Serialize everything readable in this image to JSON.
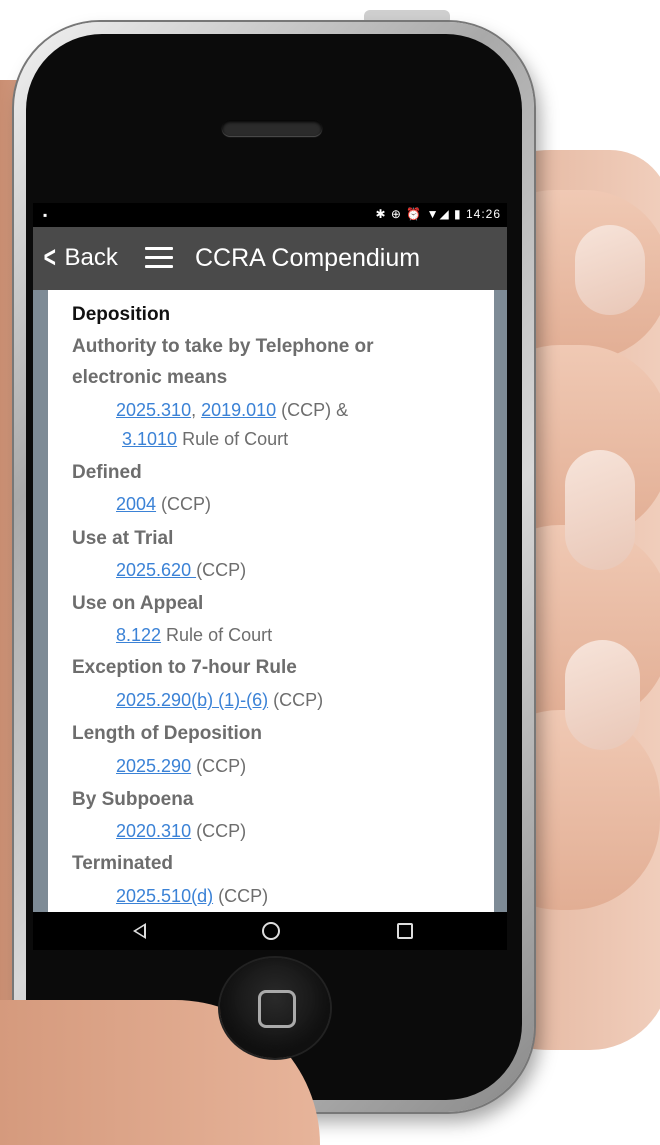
{
  "statusbar": {
    "left_icon": "notification-icon",
    "right_icons": "✱ ⊕ ⏰ ▼◢ ▮",
    "time": "14:26"
  },
  "appbar": {
    "back_label": "Back",
    "title": "CCRA Compendium"
  },
  "content": {
    "heading": "Deposition",
    "entries": [
      {
        "title_line1": "Authority to take by Telephone or",
        "title_line2": "electronic means"
      },
      {
        "title": "Defined"
      },
      {
        "title": "Use at Trial"
      },
      {
        "title": "Use on Appeal"
      },
      {
        "title": "Exception to 7-hour Rule"
      },
      {
        "title": "Length of Deposition"
      },
      {
        "title": "By Subpoena"
      },
      {
        "title": "Terminated"
      }
    ],
    "refs": {
      "r1a": "2025.310",
      "r1sep": ", ",
      "r1b": "2019.010",
      "r1tail": "  (CCP)  &",
      "r1c": "3.1010",
      "r1ctail": " Rule of Court",
      "r2": "2004",
      "r2tail": "  (CCP)",
      "r3": "2025.620 ",
      "r3tail": "(CCP)",
      "r4": "8.122",
      "r4tail": " Rule of Court",
      "r5": "2025.290(b) (1)-(6)",
      "r5tail": " (CCP)",
      "r6": "2025.290",
      "r6tail": "  (CCP)",
      "r7": "2020.310",
      "r7tail": " (CCP)",
      "r8": "2025.510(d)",
      "r8tail": "  (CCP)"
    }
  },
  "colors": {
    "link": "#3b82d6",
    "appbar": "#4a4a4a",
    "screen_frame": "#7e8b96"
  }
}
